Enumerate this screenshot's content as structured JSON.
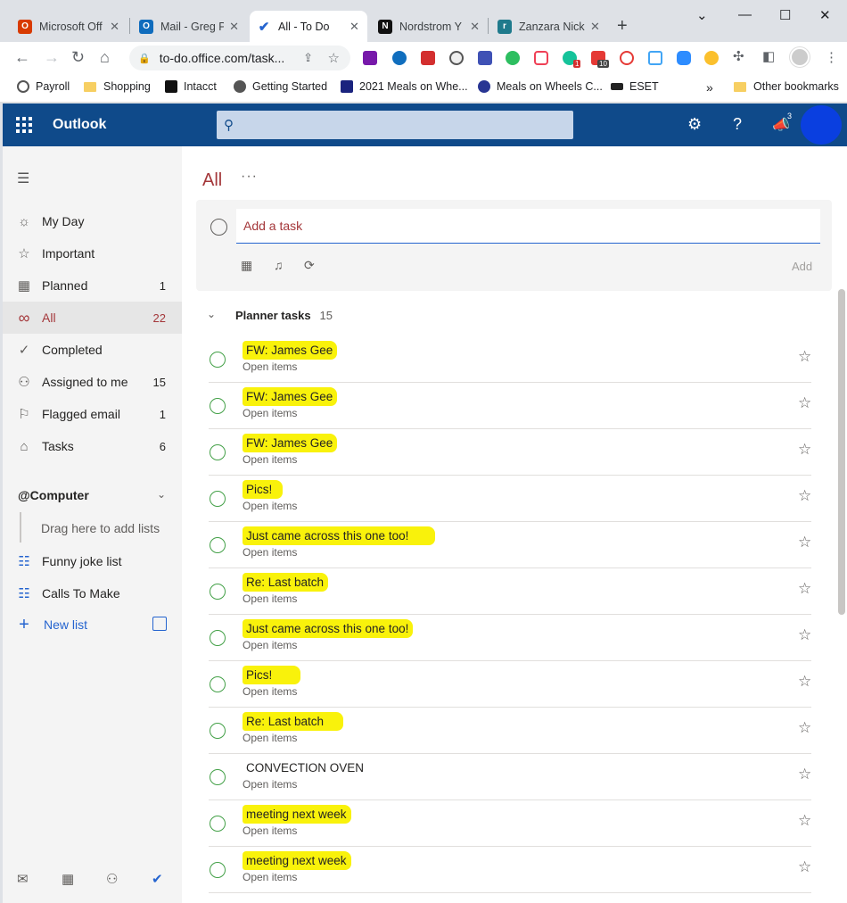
{
  "browser": {
    "tabs": [
      {
        "label": "Microsoft Off",
        "fav_color": "#d83b01",
        "active": false
      },
      {
        "label": "Mail - Greg P",
        "fav_color": "#0f6cbd",
        "active": false
      },
      {
        "label": "All - To Do",
        "fav_color": "#2564cf",
        "active": true
      },
      {
        "label": "Nordstrom Y",
        "fav_color": "#111111",
        "active": false
      },
      {
        "label": "Zanzara Nick",
        "fav_color": "#1f7a8c",
        "active": false
      }
    ],
    "address": "to-do.office.com/task...",
    "bookmarks": [
      {
        "label": "Payroll",
        "icon": "payroll-icon"
      },
      {
        "label": "Shopping",
        "icon": "folder-icon"
      },
      {
        "label": "Intacct",
        "icon": "intacct-icon"
      },
      {
        "label": "Getting Started",
        "icon": "globe-icon"
      },
      {
        "label": "2021 Meals on Whe...",
        "icon": "meals-icon"
      },
      {
        "label": "Meals on Wheels C...",
        "icon": "mow-icon"
      },
      {
        "label": "ESET",
        "icon": "eset-icon"
      },
      {
        "label": "Other bookmarks",
        "icon": "folder-icon"
      }
    ],
    "extension_badges": [
      "1",
      "10"
    ]
  },
  "outlook": {
    "brand": "Outlook",
    "notification_count": "3"
  },
  "sidebar": {
    "items": [
      {
        "label": "My Day",
        "count": "",
        "icon": "sun-icon"
      },
      {
        "label": "Important",
        "count": "",
        "icon": "star-icon"
      },
      {
        "label": "Planned",
        "count": "1",
        "icon": "calendar-icon"
      },
      {
        "label": "All",
        "count": "22",
        "icon": "infinity-icon"
      },
      {
        "label": "Completed",
        "count": "",
        "icon": "check-circle-icon"
      },
      {
        "label": "Assigned to me",
        "count": "15",
        "icon": "person-icon"
      },
      {
        "label": "Flagged email",
        "count": "1",
        "icon": "flag-icon"
      },
      {
        "label": "Tasks",
        "count": "6",
        "icon": "home-icon"
      }
    ],
    "group_name": "@Computer",
    "drag_hint": "Drag here to add lists",
    "lists": [
      {
        "label": "Funny joke list",
        "icon": "list-icon"
      },
      {
        "label": "Calls To Make",
        "icon": "list-icon"
      }
    ],
    "new_list": "New list"
  },
  "main": {
    "title": "All",
    "more": "···",
    "add_placeholder": "Add a task",
    "add_button": "Add",
    "group": {
      "name": "Planner tasks",
      "count": "15"
    },
    "tasks": [
      {
        "title": "FW: James Gee",
        "sub": "Open items",
        "highlighted": true
      },
      {
        "title": "FW: James Gee",
        "sub": "Open items",
        "highlighted": true
      },
      {
        "title": "FW: James Gee",
        "sub": "Open items",
        "highlighted": true
      },
      {
        "title": "Pics!",
        "sub": "Open items",
        "highlighted": true
      },
      {
        "title": "Just came across this one too!",
        "sub": "Open items",
        "highlighted": true
      },
      {
        "title": "Re: Last batch",
        "sub": "Open items",
        "highlighted": true
      },
      {
        "title": "Just came across this one too!",
        "sub": "Open items",
        "highlighted": true
      },
      {
        "title": "Pics!",
        "sub": "Open items",
        "highlighted": true
      },
      {
        "title": "Re: Last batch",
        "sub": "Open items",
        "highlighted": true
      },
      {
        "title": "CONVECTION OVEN",
        "sub": "Open items",
        "highlighted": false
      },
      {
        "title": "meeting next week",
        "sub": "Open items",
        "highlighted": true
      },
      {
        "title": "meeting next week",
        "sub": "Open items",
        "highlighted": true
      }
    ]
  },
  "colors": {
    "accent": "#a4373a",
    "header": "#0f4a8a",
    "link": "#2564cf",
    "highlight": "#f9f20b",
    "task_circle": "#43a047"
  }
}
